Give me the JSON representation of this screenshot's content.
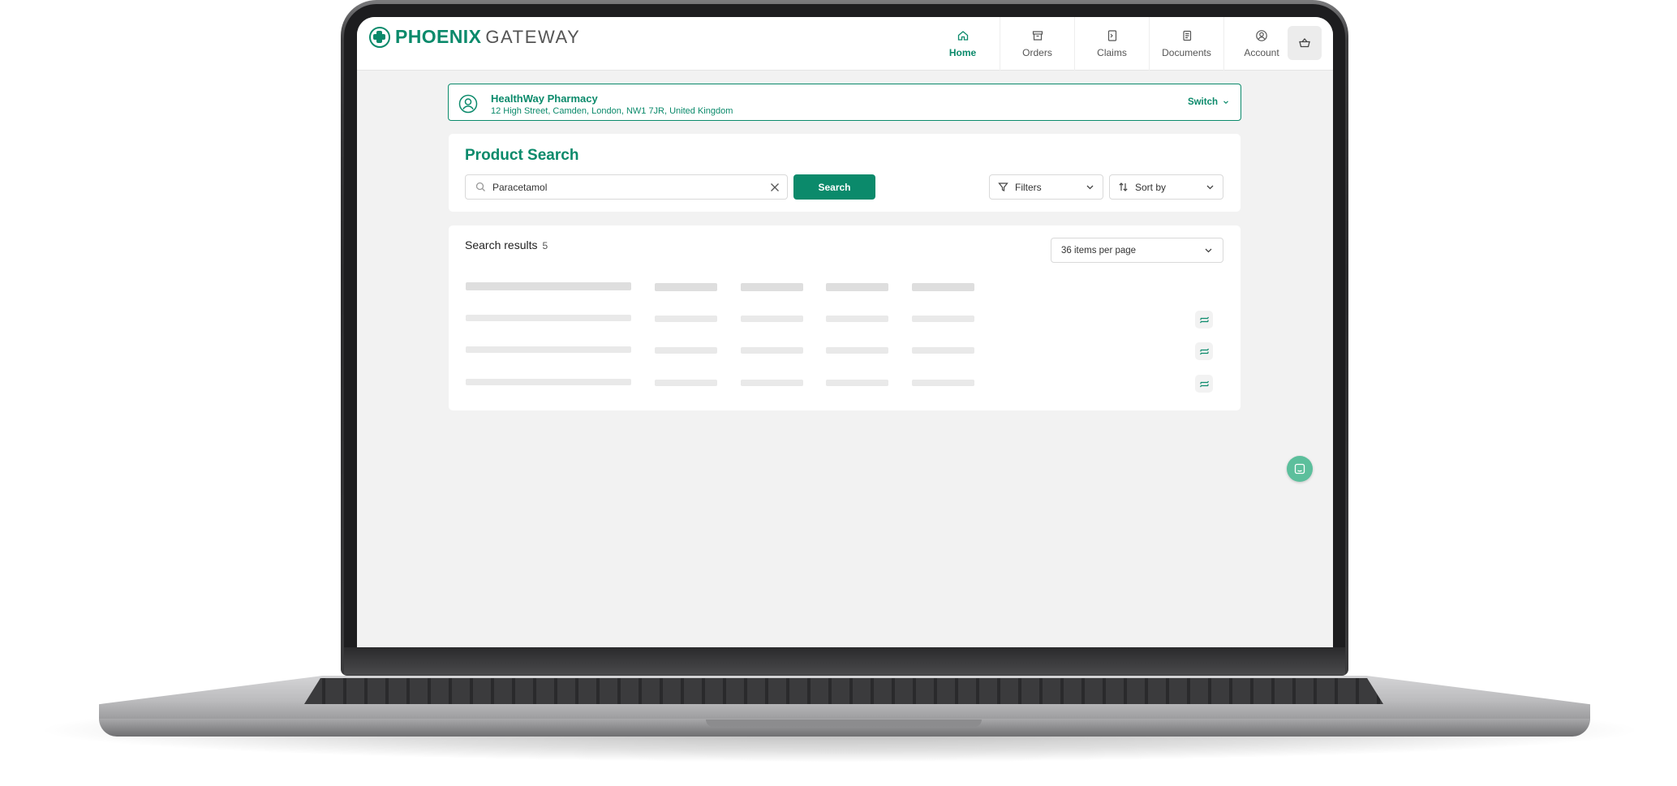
{
  "app": {
    "logo_bold": "PHOENIX",
    "logo_light": "GATEWAY",
    "accent_color": "#0b8a6b"
  },
  "nav": {
    "items": [
      {
        "label": "Home",
        "icon": "home-icon",
        "active": true
      },
      {
        "label": "Orders",
        "icon": "orders-box-icon",
        "active": false
      },
      {
        "label": "Claims",
        "icon": "claims-document-icon",
        "active": false
      },
      {
        "label": "Documents",
        "icon": "documents-icon",
        "active": false
      },
      {
        "label": "Account",
        "icon": "account-user-icon",
        "active": false
      }
    ],
    "cart_icon": "basket-icon"
  },
  "pharmacy": {
    "name": "HealthWay Pharmacy",
    "address": "12 High Street, Camden, London, NW1 7JR, United Kingdom",
    "switch_label": "Switch"
  },
  "search": {
    "title": "Product Search",
    "value": "Paracetamol",
    "button_label": "Search",
    "filters_label": "Filters",
    "sort_label": "Sort by"
  },
  "results": {
    "title": "Search results",
    "count": "5",
    "per_page_label": "36 items per page",
    "loading_rows": 3
  }
}
